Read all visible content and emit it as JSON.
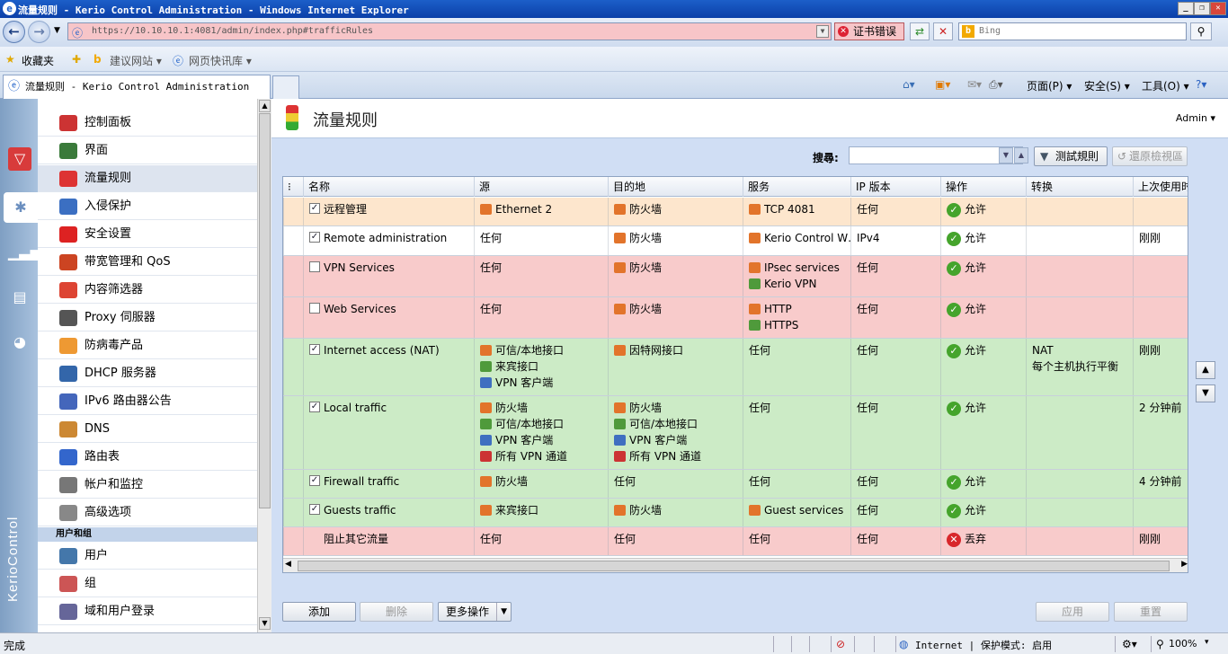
{
  "window": {
    "title": "流量规则 - Kerio Control Administration - Windows Internet Explorer"
  },
  "browser": {
    "address": "https://10.10.10.1:4081/admin/index.php#trafficRules",
    "cert_error": "证书错误",
    "search_placeholder": "Bing",
    "favorites": "收藏夹",
    "suggested_sites": "建议网站 ▾",
    "web_slices": "网页快讯库 ▾",
    "tab_title": "流量规则 - Kerio Control Administration",
    "menu_page": "页面(P) ▾",
    "menu_safety": "安全(S) ▾",
    "menu_tools": "工具(O) ▾"
  },
  "sidebar": {
    "brand": "KerioControl",
    "items": [
      {
        "label": "控制面板",
        "color": "#c33"
      },
      {
        "label": "界面",
        "color": "#3a7a3a"
      },
      {
        "label": "流量规则",
        "color": "#d33"
      },
      {
        "label": "入侵保护",
        "color": "#3b6fc2"
      },
      {
        "label": "安全设置",
        "color": "#d22"
      },
      {
        "label": "带宽管理和 QoS",
        "color": "#c42"
      },
      {
        "label": "内容筛选器",
        "color": "#d43"
      },
      {
        "label": "Proxy 伺服器",
        "color": "#555"
      },
      {
        "label": "防病毒产品",
        "color": "#e93"
      },
      {
        "label": "DHCP 服务器",
        "color": "#36a"
      },
      {
        "label": "IPv6 路由器公告",
        "color": "#46b"
      },
      {
        "label": "DNS",
        "color": "#c83"
      },
      {
        "label": "路由表",
        "color": "#36c"
      },
      {
        "label": "帐户和监控",
        "color": "#777"
      },
      {
        "label": "高级选项",
        "color": "#888"
      }
    ],
    "section_users": "用户和组",
    "user_items": [
      {
        "label": "用户",
        "color": "#47a"
      },
      {
        "label": "组",
        "color": "#c55"
      },
      {
        "label": "域和用户登录",
        "color": "#669"
      }
    ]
  },
  "main": {
    "page_title": "流量规则",
    "admin_menu": "Admin ▾",
    "search_label": "搜尋:",
    "test_rules_button": "测試規則",
    "restore_view_button": "還原檢視區",
    "columns": [
      "名称",
      "源",
      "目的地",
      "服务",
      "IP 版本",
      "操作",
      "转换",
      "上次使用时"
    ],
    "rules": [
      {
        "checked": true,
        "name": "远程管理",
        "source": [
          "Ethernet 2"
        ],
        "dest": [
          "防火墙"
        ],
        "service": [
          "TCP 4081"
        ],
        "ipver": "任何",
        "action": "允许",
        "action_ok": true,
        "nat": [],
        "last": "",
        "bg": "#fde6cd"
      },
      {
        "checked": true,
        "name": "Remote administration",
        "source": [
          "任何"
        ],
        "dest": [
          "防火墙"
        ],
        "service": [
          "Kerio Control W…"
        ],
        "ipver": "IPv4",
        "action": "允许",
        "action_ok": true,
        "nat": [],
        "last": "刚刚",
        "bg": "#ffffff"
      },
      {
        "checked": false,
        "name": "VPN Services",
        "source": [
          "任何"
        ],
        "dest": [
          "防火墙"
        ],
        "service": [
          "IPsec services",
          "Kerio VPN"
        ],
        "ipver": "任何",
        "action": "允许",
        "action_ok": true,
        "nat": [],
        "last": "",
        "bg": "#f8cbcb"
      },
      {
        "checked": false,
        "name": "Web Services",
        "source": [
          "任何"
        ],
        "dest": [
          "防火墙"
        ],
        "service": [
          "HTTP",
          "HTTPS"
        ],
        "ipver": "任何",
        "action": "允许",
        "action_ok": true,
        "nat": [],
        "last": "",
        "bg": "#f8cbcb"
      },
      {
        "checked": true,
        "name": "Internet access (NAT)",
        "source": [
          "可信/本地接口",
          "来宾接口",
          "VPN 客户端"
        ],
        "dest": [
          "因特网接口"
        ],
        "service": [
          "任何"
        ],
        "ipver": "任何",
        "action": "允许",
        "action_ok": true,
        "nat": [
          "NAT",
          "每个主机执行平衡"
        ],
        "last": "刚刚",
        "bg": "#ccebc6"
      },
      {
        "checked": true,
        "name": "Local traffic",
        "source": [
          "防火墙",
          "可信/本地接口",
          "VPN 客户端",
          "所有 VPN 通道"
        ],
        "dest": [
          "防火墙",
          "可信/本地接口",
          "VPN 客户端",
          "所有 VPN 通道"
        ],
        "service": [
          "任何"
        ],
        "ipver": "任何",
        "action": "允许",
        "action_ok": true,
        "nat": [],
        "last": "2 分钟前",
        "bg": "#ccebc6"
      },
      {
        "checked": true,
        "name": "Firewall traffic",
        "source": [
          "防火墙"
        ],
        "dest": [
          "任何"
        ],
        "service": [
          "任何"
        ],
        "ipver": "任何",
        "action": "允许",
        "action_ok": true,
        "nat": [],
        "last": "4 分钟前",
        "bg": "#ccebc6"
      },
      {
        "checked": true,
        "name": "Guests traffic",
        "source": [
          "来宾接口"
        ],
        "dest": [
          "防火墙"
        ],
        "service": [
          "Guest services"
        ],
        "ipver": "任何",
        "action": "允许",
        "action_ok": true,
        "nat": [],
        "last": "",
        "bg": "#ccebc6"
      },
      {
        "checked": null,
        "name": "阻止其它流量",
        "source": [
          "任何"
        ],
        "dest": [
          "任何"
        ],
        "service": [
          "任何"
        ],
        "ipver": "任何",
        "action": "丢弃",
        "action_ok": false,
        "nat": [],
        "last": "刚刚",
        "bg": "#f8cbcb"
      }
    ],
    "buttons": {
      "add": "添加",
      "delete": "删除",
      "more": "更多操作",
      "apply": "应用",
      "reset": "重置"
    }
  },
  "statusbar": {
    "left": "完成",
    "zone": "Internet | 保护模式: 启用",
    "zoom": "100%"
  }
}
